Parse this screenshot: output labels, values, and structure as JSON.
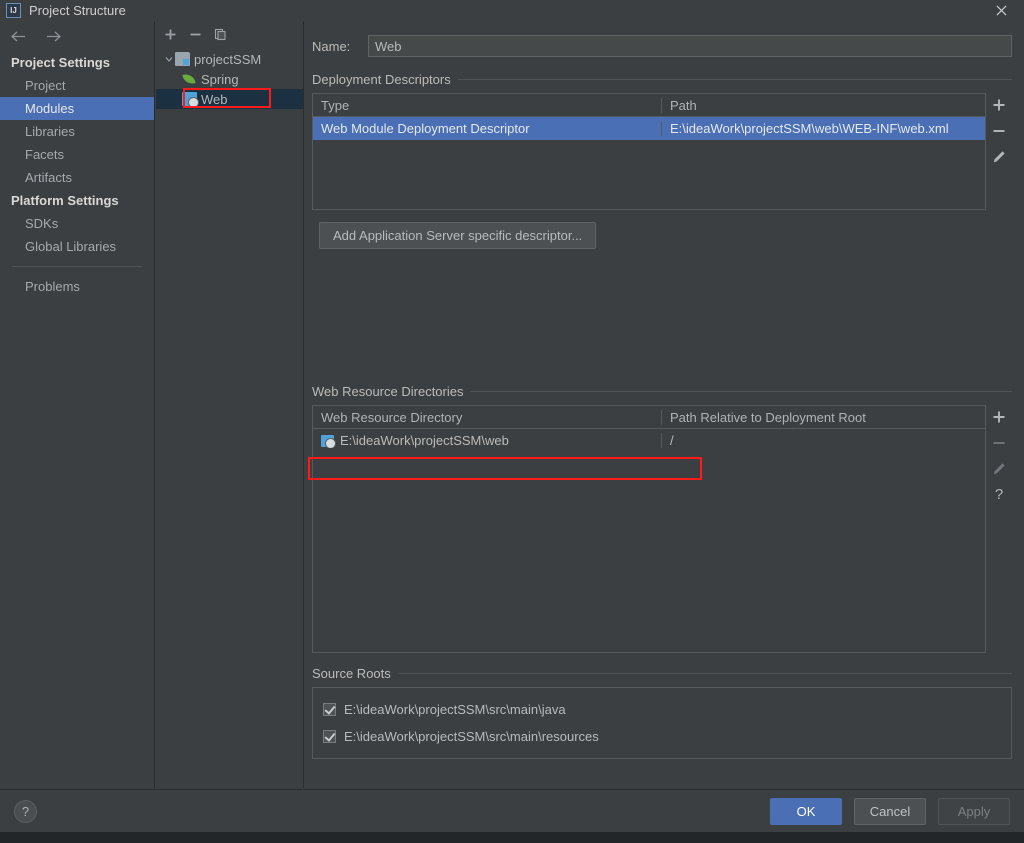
{
  "window": {
    "title": "Project Structure",
    "logo_icon": "intellij-idea-logo",
    "close_icon": "close-icon"
  },
  "nav": {
    "back_icon": "arrow-left-icon",
    "forward_icon": "arrow-right-icon"
  },
  "sidebar": {
    "groups": [
      {
        "label": "Project Settings"
      },
      {
        "label": "Platform Settings"
      }
    ],
    "items": [
      {
        "label": "Project",
        "selected": false
      },
      {
        "label": "Modules",
        "selected": true
      },
      {
        "label": "Libraries",
        "selected": false
      },
      {
        "label": "Facets",
        "selected": false
      },
      {
        "label": "Artifacts",
        "selected": false
      },
      {
        "label": "SDKs",
        "selected": false
      },
      {
        "label": "Global Libraries",
        "selected": false
      },
      {
        "label": "Problems",
        "selected": false
      }
    ]
  },
  "tree": {
    "toolbar": [
      {
        "icon": "plus-icon",
        "label": "Add"
      },
      {
        "icon": "minus-icon",
        "label": "Remove"
      },
      {
        "icon": "copy-icon",
        "label": "Copy"
      }
    ],
    "nodes": [
      {
        "label": "projectSSM",
        "icon": "module-icon",
        "level": 1,
        "expanded": true,
        "selected": false
      },
      {
        "label": "Spring",
        "icon": "spring-facet-icon",
        "level": 2,
        "selected": false
      },
      {
        "label": "Web",
        "icon": "web-facet-icon",
        "level": 2,
        "selected": true
      }
    ]
  },
  "main": {
    "name_label": "Name:",
    "name_value": "Web",
    "deployment_descriptors": {
      "title": "Deployment Descriptors",
      "columns": [
        "Type",
        "Path"
      ],
      "rows": [
        {
          "type": "Web Module Deployment Descriptor",
          "path": "E:\\ideaWork\\projectSSM\\web\\WEB-INF\\web.xml",
          "selected": true
        }
      ],
      "tools": [
        {
          "icon": "plus-icon",
          "label": "Add",
          "enabled": true
        },
        {
          "icon": "minus-icon",
          "label": "Remove",
          "enabled": true
        },
        {
          "icon": "pencil-icon",
          "label": "Edit",
          "enabled": true
        }
      ]
    },
    "add_descriptor_button": "Add Application Server specific descriptor...",
    "web_resource_directories": {
      "title": "Web Resource Directories",
      "columns": [
        "Web Resource Directory",
        "Path Relative to Deployment Root"
      ],
      "rows": [
        {
          "directory": "E:\\ideaWork\\projectSSM\\web",
          "relative_path": "/",
          "icon": "folder-web-icon",
          "highlighted": true
        }
      ],
      "tools": [
        {
          "icon": "plus-icon",
          "label": "Add",
          "enabled": true
        },
        {
          "icon": "minus-icon",
          "label": "Remove",
          "enabled": false
        },
        {
          "icon": "pencil-icon",
          "label": "Edit",
          "enabled": false
        },
        {
          "icon": "question-icon",
          "label": "Help",
          "enabled": true
        }
      ]
    },
    "source_roots": {
      "title": "Source Roots",
      "items": [
        {
          "label": "E:\\ideaWork\\projectSSM\\src\\main\\java",
          "checked": true
        },
        {
          "label": "E:\\ideaWork\\projectSSM\\src\\main\\resources",
          "checked": true
        }
      ]
    }
  },
  "footer": {
    "help_icon": "question-icon",
    "ok_label": "OK",
    "cancel_label": "Cancel",
    "apply_label": "Apply"
  },
  "colors": {
    "background": "#3c3f41",
    "selection_blue": "#4a6fb5",
    "tree_selection": "#1b3040",
    "annotation_red": "#ff1a1a",
    "border": "#555a5c",
    "text": "#bbbbbb"
  }
}
